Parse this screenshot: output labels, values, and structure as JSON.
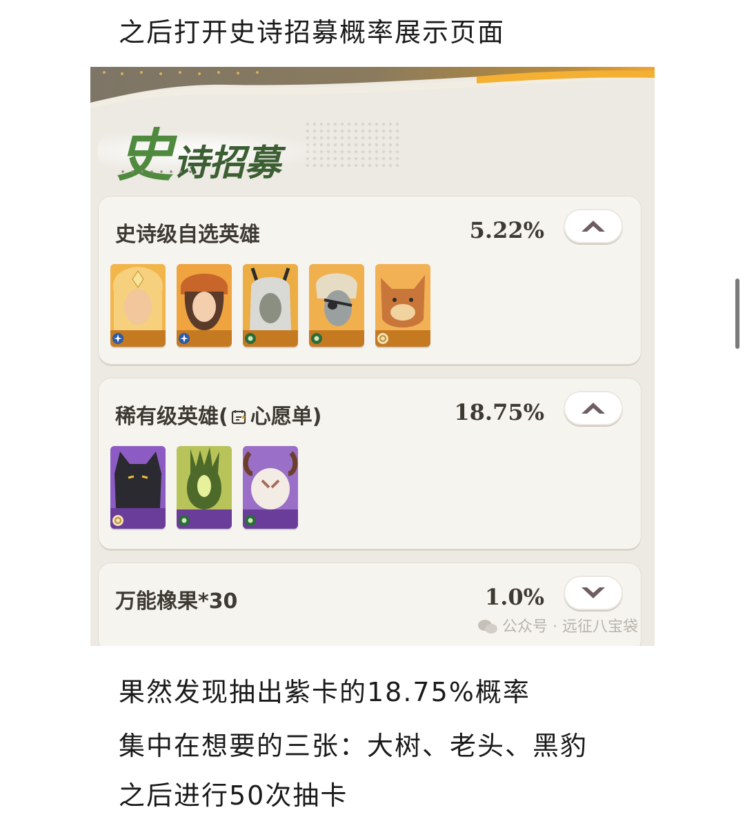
{
  "article": {
    "intro": "之后打开史诗招募概率展示页面",
    "conclusion_lines": [
      "果然发现抽出紫卡的18.75%概率",
      "集中在想要的三张：大树、老头、黑豹",
      "之后进行50次抽卡"
    ]
  },
  "screenshot": {
    "title": "史诗招募",
    "rows": [
      {
        "label": "史诗级自选英雄",
        "rate": "5.22%",
        "expanded": true,
        "heroes": [
          {
            "name": "hero-1",
            "frame": "#e39a2f",
            "faction": "sparkle"
          },
          {
            "name": "hero-2",
            "frame": "#e39a2f",
            "faction": "sparkle"
          },
          {
            "name": "hero-3",
            "frame": "#e39a2f",
            "faction": "leaf"
          },
          {
            "name": "hero-4",
            "frame": "#e39a2f",
            "faction": "leaf"
          },
          {
            "name": "hero-5",
            "frame": "#e39a2f",
            "faction": "sun"
          }
        ]
      },
      {
        "label_prefix": "稀有级英雄",
        "label_paren_open": "(",
        "label_wish": "心愿单",
        "label_paren_close": ")",
        "rate": "18.75%",
        "expanded": true,
        "heroes": [
          {
            "name": "black-panther",
            "frame": "#7c4cb0",
            "faction": "sun"
          },
          {
            "name": "big-tree",
            "frame": "#7c4cb0",
            "faction": "leaf"
          },
          {
            "name": "old-man",
            "frame": "#7c4cb0",
            "faction": "leaf"
          }
        ]
      },
      {
        "label": "万能橡果*30",
        "rate": "1.0%",
        "expanded": false
      }
    ],
    "watermark": "公众号 · 远征八宝袋"
  },
  "colors": {
    "title_green": "#4f8a3f",
    "epic_frame": "#e39a2f",
    "rare_frame": "#7c4cb0",
    "panel_bg": "#f6f4ef"
  }
}
